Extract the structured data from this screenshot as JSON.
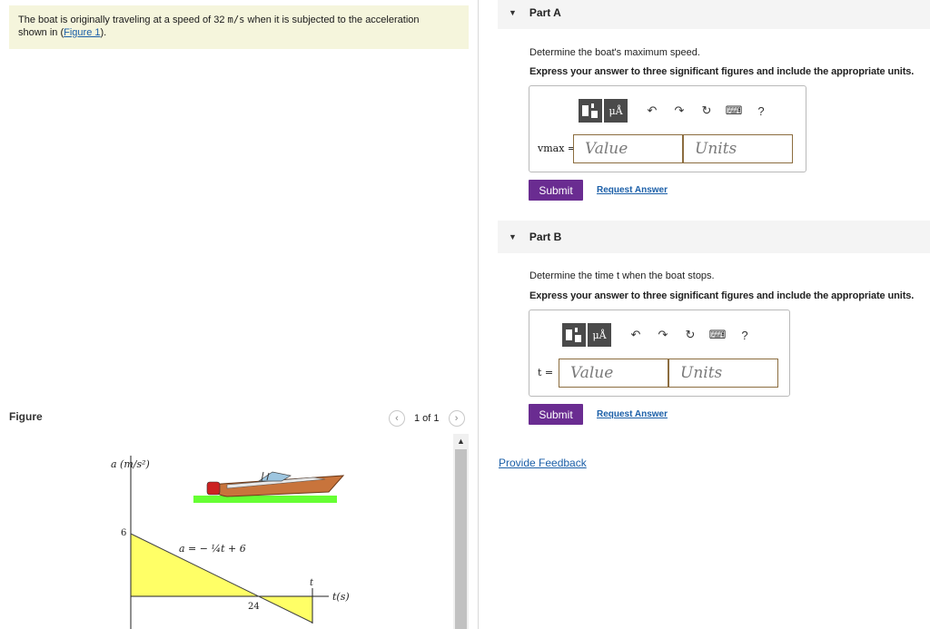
{
  "problem": {
    "text_before": "The boat is originally traveling at a speed of 32 ",
    "unit": "m/s",
    "text_after": " when it is subjected to the acceleration",
    "line2_before": "shown in (",
    "figure_link": "Figure 1",
    "line2_after": ")."
  },
  "figure": {
    "label": "Figure",
    "pager": {
      "prev": "‹",
      "count": "1 of 1",
      "next": "›"
    },
    "scroll_up": "▲",
    "y_axis_label": "a (m/s²)",
    "y_tick": "6",
    "x_tick": "24",
    "x_axis_label": "t(s)",
    "t_marker": "t",
    "equation": "a = − ¼t + 6"
  },
  "partA": {
    "title": "Part A",
    "question": "Determine the boat's maximum speed.",
    "instruction": "Express your answer to three significant figures and include the appropriate units.",
    "variable": "vmax =",
    "value_placeholder": "Value",
    "units_placeholder": "Units",
    "submit": "Submit",
    "request": "Request Answer"
  },
  "partB": {
    "title": "Part B",
    "question": "Determine the time t when the boat stops.",
    "instruction": "Express your answer to three significant figures and include the appropriate units.",
    "variable": "t =",
    "value_placeholder": "Value",
    "units_placeholder": "Units",
    "submit": "Submit",
    "request": "Request Answer"
  },
  "toolbar": {
    "mu": "μÅ",
    "undo": "↶",
    "redo": "↷",
    "reset": "↻",
    "keyboard": "⌨",
    "help": "?"
  },
  "feedback": "Provide Feedback",
  "colors": {
    "submit": "#6a2c91",
    "link": "#1b5fa8",
    "problem_bg": "#f5f5dc",
    "field_border": "#8c6d3f",
    "graph_fill": "#ffff66"
  }
}
